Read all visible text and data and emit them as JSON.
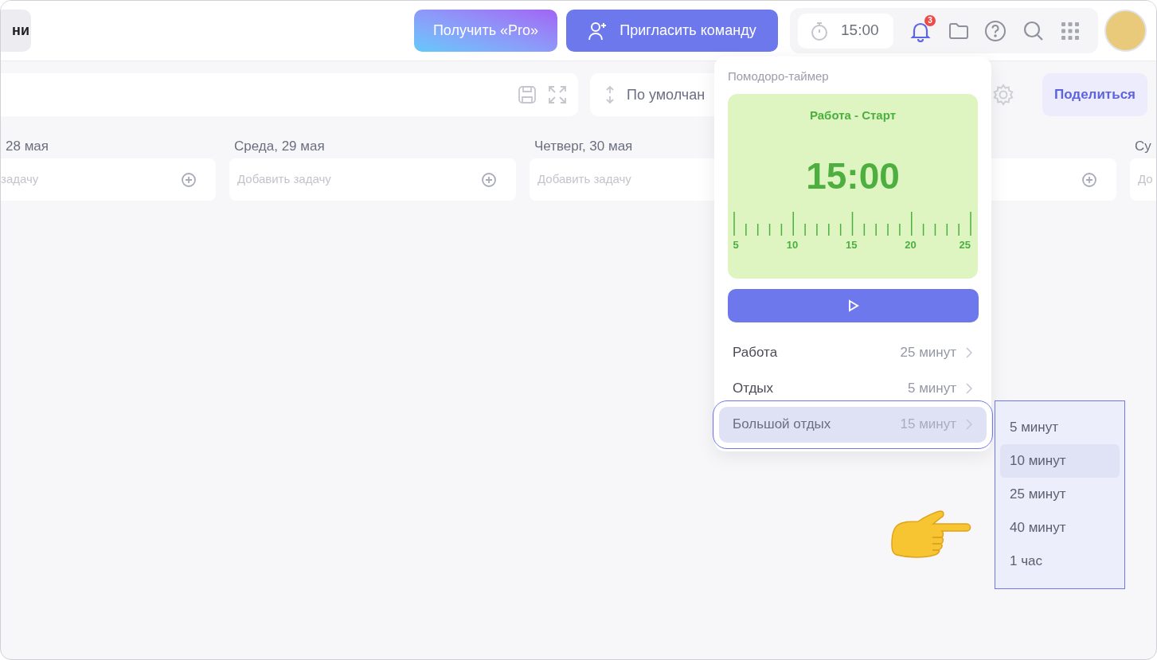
{
  "header": {
    "left_tab": "ни",
    "pro_button": "Получить «Pro»",
    "invite_button": "Пригласить команду",
    "timer": "15:00",
    "notifications_badge": "3"
  },
  "toolbar": {
    "sort_label": "По умолчан",
    "share_button": "Поделиться"
  },
  "days": [
    {
      "header": "28 мая",
      "placeholder": "задачу",
      "add_icon": true
    },
    {
      "header": "Среда, 29 мая",
      "placeholder": "Добавить задачу",
      "add_icon": true
    },
    {
      "header": "Четверг, 30 мая",
      "placeholder": "Добавить задачу",
      "add_icon": false
    },
    {
      "add_icon": true
    },
    {
      "header": "Су",
      "placeholder": "До",
      "add_icon": false
    }
  ],
  "pomodoro": {
    "title": "Помодоро-таймер",
    "phase": "Работа - Старт",
    "time": "15:00",
    "scale_labels": [
      "5",
      "10",
      "15",
      "20",
      "25"
    ],
    "settings": [
      {
        "label": "Работа",
        "value": "25 минут",
        "selected": false
      },
      {
        "label": "Отдых",
        "value": "5 минут",
        "selected": false
      },
      {
        "label": "Большой отдых",
        "value": "15 минут",
        "selected": true
      }
    ]
  },
  "duration_menu": [
    {
      "label": "5 минут",
      "selected": false
    },
    {
      "label": "10 минут",
      "selected": true
    },
    {
      "label": "25 минут",
      "selected": false
    },
    {
      "label": "40 минут",
      "selected": false
    },
    {
      "label": "1 час",
      "selected": false
    }
  ]
}
